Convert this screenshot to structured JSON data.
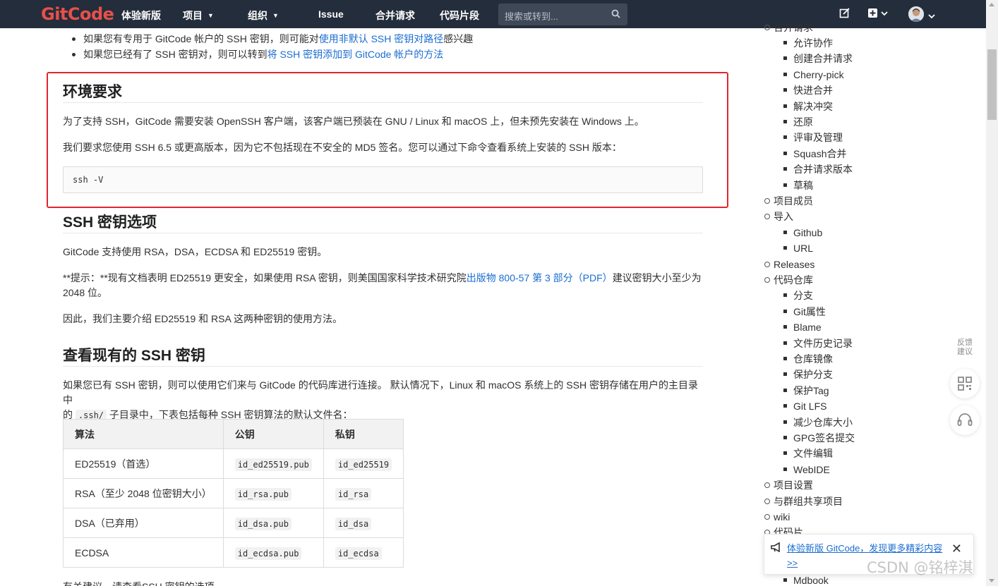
{
  "navbar": {
    "logo": "GitCode",
    "items": [
      "体验新版",
      "项目",
      "组织",
      "Issue",
      "合并请求",
      "代码片段"
    ],
    "search_placeholder": "搜索或转到..."
  },
  "intro_bullets": [
    {
      "pre": "如果您有专用于 GitCode 帐户的 SSH 密钥，则可能对",
      "link": "使用非默认 SSH 密钥对路径",
      "post": "感兴趣"
    },
    {
      "pre": "如果您已经有了 SSH 密钥对，则可以转到",
      "link": "将 SSH 密钥添加到 GitCode 帐户的方法",
      "post": ""
    }
  ],
  "env": {
    "title": "环境要求",
    "p1": "为了支持 SSH，GitCode 需要安装 OpenSSH 客户端，该客户端已预装在 GNU / Linux 和 macOS 上，但未预先安装在 Windows 上。",
    "p2": "我们要求您使用 SSH 6.5 或更高版本，因为它不包括现在不安全的 MD5 签名。您可以通过下命令查看系统上安装的 SSH 版本：",
    "code": "ssh -V"
  },
  "options": {
    "title": "SSH 密钥选项",
    "p1": "GitCode 支持使用 RSA，DSA，ECDSA 和 ED25519 密钥。",
    "tip_pre": "**提示：**现有文档表明 ED25519 更安全，如果使用 RSA 密钥，则美国国家科学技术研究院",
    "tip_link": "出版物 800-57 第 3 部分（PDF）",
    "tip_post": "建议密钥大小至少为",
    "tip_line2": "2048 位。",
    "p3": "因此，我们主要介绍 ED25519 和 RSA 这两种密钥的使用方法。"
  },
  "existing": {
    "title": "查看现有的 SSH 密钥",
    "p1_line1": "如果您已有 SSH 密钥，则可以使用它们来与 GitCode 的代码库进行连接。 默认情况下，Linux 和 macOS 系统上的 SSH 密钥存储在用户的主目录中",
    "p1_pre2": "的",
    "p1_code": ".ssh/",
    "p1_post2": "子目录中，下表包括每种 SSH 密钥算法的默认文件名：",
    "table": {
      "headers": [
        "算法",
        "公钥",
        "私钥"
      ],
      "rows": [
        [
          "ED25519（首选）",
          "id_ed25519.pub",
          "id_ed25519"
        ],
        [
          "RSA（至少 2048 位密钥大小）",
          "id_rsa.pub",
          "id_rsa"
        ],
        [
          "DSA（已弃用）",
          "id_dsa.pub",
          "id_dsa"
        ],
        [
          "ECDSA",
          "id_ecdsa.pub",
          "id_ecdsa"
        ]
      ]
    },
    "trailing": "有关建议，请查看SSH 密钥的选项。"
  },
  "toc": {
    "top_cut": "合并请求",
    "groups": [
      {
        "label": null,
        "children": [
          "允许协作",
          "创建合并请求",
          "Cherry-pick",
          "快进合并",
          "解决冲突",
          "还原",
          "评审及管理",
          "Squash合并",
          "合并请求版本",
          "草稿"
        ]
      },
      {
        "label": "项目成员",
        "children": []
      },
      {
        "label": "导入",
        "children": [
          "Github",
          "URL"
        ]
      },
      {
        "label": "Releases",
        "children": []
      },
      {
        "label": "代码仓库",
        "children": [
          "分支",
          "Git属性",
          "Blame",
          "文件历史记录",
          "仓库镜像",
          "保护分支",
          "保护Tag",
          "Git LFS",
          "减少仓库大小",
          "GPG签名提交",
          "文件编辑",
          "WebIDE"
        ]
      },
      {
        "label": "项目设置",
        "children": []
      },
      {
        "label": "与群组共享项目",
        "children": []
      },
      {
        "label": "wiki",
        "children": []
      },
      {
        "label": "代码片",
        "children": []
      }
    ],
    "bottom_item": "Mdbook"
  },
  "sidetools": {
    "feedback": "反馈建议"
  },
  "notice": {
    "text": "体验新版 GitCode，发现更多精彩内容 >>",
    "close": "✕"
  },
  "watermark": "CSDN @铭梓淇",
  "colors": {
    "navbar": "#232d3b",
    "link": "#1a6dd1",
    "highlight_box": "#e0262d",
    "logo": "#e8504a"
  }
}
